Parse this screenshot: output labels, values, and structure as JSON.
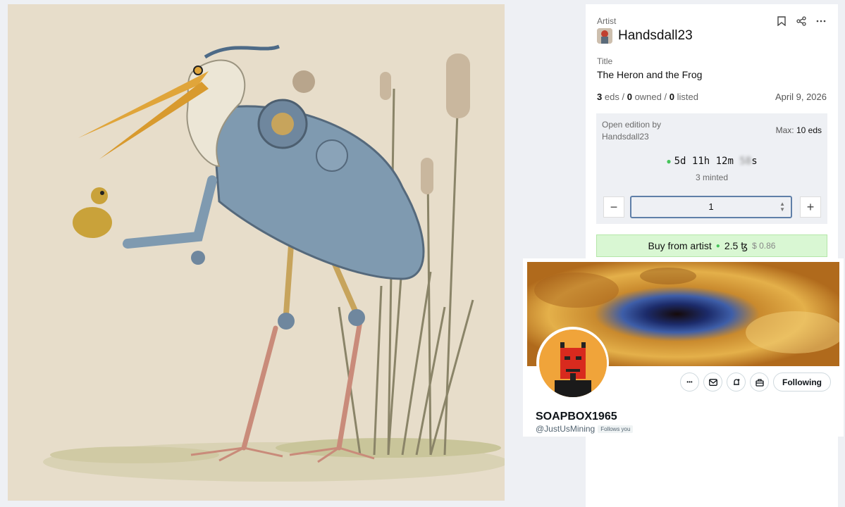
{
  "artwork": {
    "alt_subject": "heron-robot-and-frog"
  },
  "panel": {
    "artist_label": "Artist",
    "artist_name": "Handsdall23",
    "title_label": "Title",
    "title": "The Heron and the Frog",
    "stats": {
      "eds": "3",
      "eds_label": "eds",
      "owned": "0",
      "owned_label": "owned",
      "listed": "0",
      "listed_label": "listed",
      "sep": "/"
    },
    "date": "April 9, 2026",
    "icons": [
      "bookmark-icon",
      "share-icon",
      "more-icon"
    ],
    "mint": {
      "open_edition_label": "Open edition by",
      "open_edition_by": "Handsdall23",
      "max_label": "Max:",
      "max_value": "10 eds",
      "countdown_main": "5d 11h 12m ",
      "countdown_seconds": "58",
      "countdown_unit": "s",
      "minted": "3 minted",
      "quantity": "1",
      "minus": "−",
      "plus": "+"
    },
    "buy": {
      "label": "Buy from artist",
      "price": "2.5 ꜩ",
      "usd": "$ 0.86"
    }
  },
  "profile": {
    "name": "SOAPBOX1965",
    "handle": "@JustUsMining",
    "follows_you": "Follows you",
    "follow_label": "Following",
    "more": "•••"
  },
  "colors": {
    "accent_green": "#46c45a",
    "buy_bg": "#d9f7d3",
    "panel_bg": "#eef0f4"
  }
}
